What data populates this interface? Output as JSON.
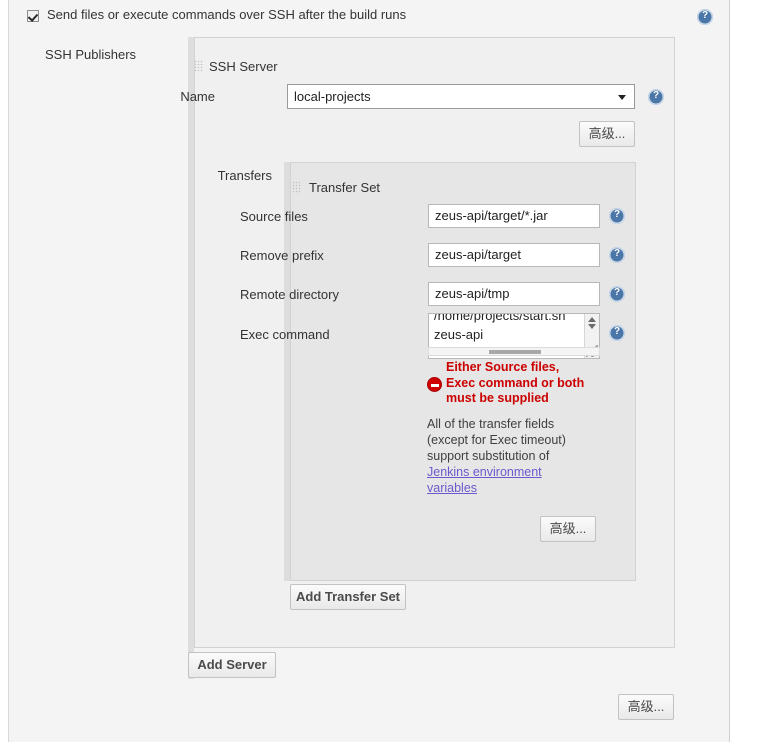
{
  "header": {
    "checkbox_label": "Send files or execute commands over SSH after the build runs",
    "checkbox_checked": true,
    "help_icon": "help-icon"
  },
  "section": {
    "label": "SSH Publishers"
  },
  "server_panel": {
    "title": "SSH Server",
    "grip_icon": "drag-grip-icon",
    "name_label": "Name",
    "name_value": "local-projects",
    "name_options": [
      "local-projects"
    ],
    "dropdown_icon": "chevron-down-icon",
    "advanced_button": "高级...",
    "help_icon": "help-icon"
  },
  "transfers": {
    "label": "Transfers",
    "panel_title": "Transfer Set",
    "grip_icon": "drag-grip-icon",
    "fields": [
      {
        "label": "Source files",
        "value": "zeus-api/target/*.jar",
        "name": "source-files"
      },
      {
        "label": "Remove prefix",
        "value": "zeus-api/target",
        "name": "remove-prefix"
      },
      {
        "label": "Remote directory",
        "value": "zeus-api/tmp",
        "name": "remote-directory"
      }
    ],
    "exec": {
      "label": "Exec command",
      "value_line1": "/home/projects/start.sh",
      "value_line2": "zeus-api",
      "scroll_icon": "scrollbar"
    },
    "error": {
      "icon": "error-stop-icon",
      "line1": "Either Source files,",
      "line2": "Exec command or both",
      "line3": "must be supplied",
      "color": "#cc0000"
    },
    "help": {
      "line1": "All of the transfer fields",
      "line2": "(except for Exec timeout)",
      "line3": "support substitution of",
      "link1": "Jenkins environment",
      "link2": "variables"
    },
    "advanced_button": "高级...",
    "add_transfer_set_button": "Add Transfer Set"
  },
  "footer": {
    "add_server_button": "Add Server",
    "advanced_button": "高级..."
  },
  "colors": {
    "help_blue": "#4a76a8",
    "error_red": "#cc0000",
    "link_purple": "#6a5acd",
    "panel_bg": "#f0f0f0",
    "transferset_bg": "#e6e6e6",
    "page_bg": "#f4f4f4"
  }
}
